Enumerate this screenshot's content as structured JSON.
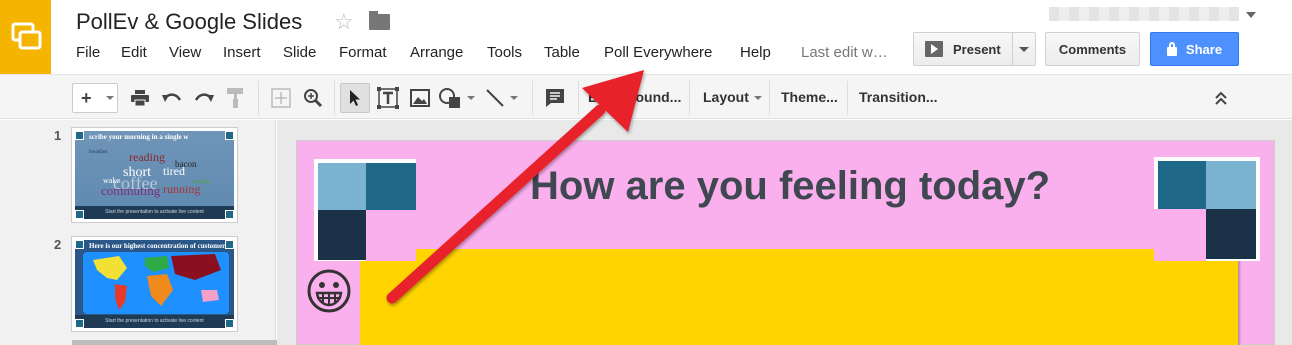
{
  "app": {
    "logo_color": "#f4b400",
    "doc_title": "PollEv & Google Slides"
  },
  "menu": [
    "File",
    "Edit",
    "View",
    "Insert",
    "Slide",
    "Format",
    "Arrange",
    "Tools",
    "Table",
    "Poll Everywhere",
    "Help"
  ],
  "last_edit": "Last edit w…",
  "buttons": {
    "present": "Present",
    "comments": "Comments",
    "share": "Share",
    "share_color": "#4d90fe"
  },
  "toolbar": {
    "icons": [
      "add-icon",
      "print-icon",
      "undo-icon",
      "redo-icon",
      "paint-format-icon",
      "zoom-fit-icon",
      "zoom-icon",
      "select-cursor-icon",
      "text-box-icon",
      "image-icon",
      "shape-icon",
      "line-icon",
      "comment-icon"
    ],
    "background": "Background...",
    "layout": "Layout",
    "theme": "Theme...",
    "transition": "Transition...",
    "collapse_icon": "chevron-double-up-icon"
  },
  "slides": [
    {
      "number": "1",
      "title": "scribe your morning in a single w",
      "footer": "Start the presentation to activate live content",
      "words": [
        "breakfast",
        "reading",
        "short",
        "tired",
        "coffee",
        "commuting",
        "running",
        "bacon",
        "energetic",
        "wake"
      ]
    },
    {
      "number": "2",
      "title": "Here is our highest concentration of customers",
      "footer": "Start the presentation to activate live content"
    }
  ],
  "current_slide": {
    "title": "How are you feeling today?",
    "background_color": "#fbb0ee",
    "panel_color": "#ffd400",
    "emoji_icon": "grinning-face-icon"
  },
  "annotation": {
    "arrow_color": "#e8202a",
    "arrow_icon": "red-arrow-icon"
  }
}
